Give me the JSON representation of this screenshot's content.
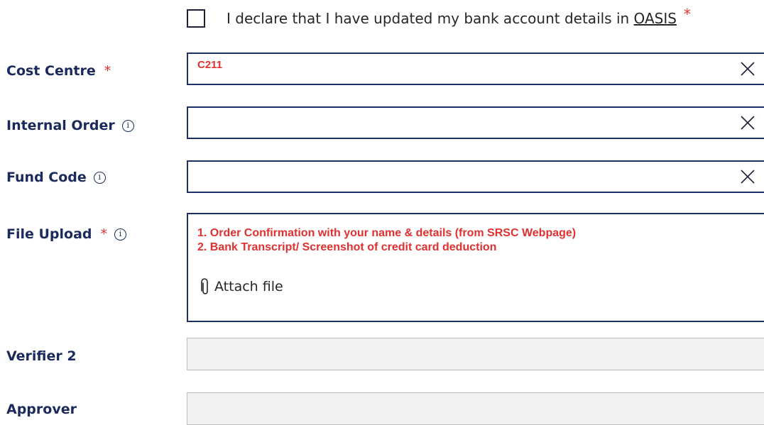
{
  "declaration": {
    "text_prefix": "I declare that I have updated my bank account details in ",
    "link": "OASIS",
    "required_mark": "*",
    "checked": false
  },
  "fields": {
    "cost_centre": {
      "label": "Cost Centre",
      "required_mark": "*",
      "value": "C211"
    },
    "internal_order": {
      "label": "Internal Order",
      "info_glyph": "i",
      "value": ""
    },
    "fund_code": {
      "label": "Fund Code",
      "info_glyph": "i",
      "value": ""
    },
    "file_upload": {
      "label": "File Upload",
      "required_mark": "*",
      "info_glyph": "i",
      "instructions": [
        "1. Order Confirmation with your name & details (from SRSC Webpage)",
        "2. Bank Transcript/ Screenshot of credit card deduction"
      ],
      "attach_label": "Attach file"
    },
    "verifier_2": {
      "label": "Verifier 2",
      "value": ""
    },
    "approver": {
      "label": "Approver",
      "value": ""
    }
  },
  "icons": {
    "clear": "close-icon",
    "info": "info-icon",
    "attach": "paperclip-icon"
  },
  "colors": {
    "label": "#1a2a5c",
    "border": "#1f2f66",
    "required": "#e0302f",
    "disabled_bg": "#f1f1f1"
  }
}
